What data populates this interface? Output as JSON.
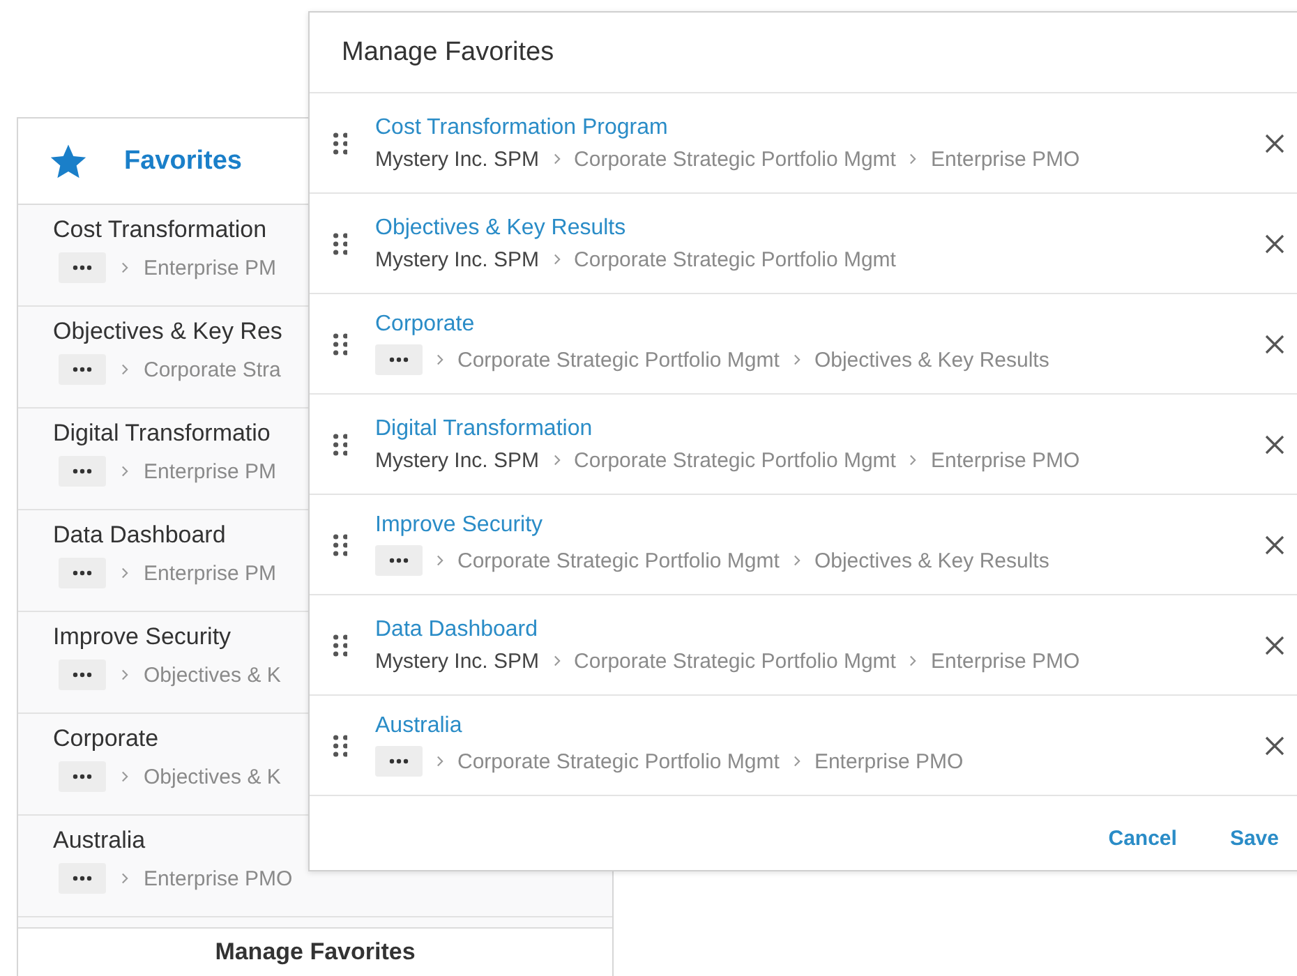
{
  "favorites_panel": {
    "title": "Favorites",
    "items": [
      {
        "title": "Cost Transformation",
        "path": [
          {
            "kind": "more"
          },
          {
            "kind": "crumb",
            "label": "Enterprise PM"
          }
        ]
      },
      {
        "title": "Objectives & Key Res",
        "path": [
          {
            "kind": "more"
          },
          {
            "kind": "crumb",
            "label": "Corporate Stra"
          }
        ]
      },
      {
        "title": "Digital Transformatio",
        "path": [
          {
            "kind": "more"
          },
          {
            "kind": "crumb",
            "label": "Enterprise PM"
          }
        ]
      },
      {
        "title": "Data Dashboard",
        "path": [
          {
            "kind": "more"
          },
          {
            "kind": "crumb",
            "label": "Enterprise PM"
          }
        ]
      },
      {
        "title": "Improve Security",
        "path": [
          {
            "kind": "more"
          },
          {
            "kind": "crumb",
            "label": "Objectives & K"
          }
        ]
      },
      {
        "title": "Corporate",
        "path": [
          {
            "kind": "more"
          },
          {
            "kind": "crumb",
            "label": "Objectives & K"
          }
        ]
      },
      {
        "title": "Australia",
        "path": [
          {
            "kind": "more"
          },
          {
            "kind": "crumb",
            "label": "Enterprise PMO"
          }
        ]
      }
    ],
    "footer_button": "Manage Favorites"
  },
  "dialog": {
    "title": "Manage Favorites",
    "items": [
      {
        "title": "Cost Transformation Program",
        "path": [
          {
            "kind": "root",
            "label": "Mystery Inc. SPM"
          },
          {
            "kind": "crumb",
            "label": "Corporate Strategic Portfolio Mgmt"
          },
          {
            "kind": "crumb",
            "label": "Enterprise PMO"
          }
        ]
      },
      {
        "title": "Objectives & Key Results",
        "path": [
          {
            "kind": "root",
            "label": "Mystery Inc. SPM"
          },
          {
            "kind": "crumb",
            "label": "Corporate Strategic Portfolio Mgmt"
          }
        ]
      },
      {
        "title": "Corporate",
        "path": [
          {
            "kind": "more"
          },
          {
            "kind": "crumb",
            "label": "Corporate Strategic Portfolio Mgmt"
          },
          {
            "kind": "crumb",
            "label": "Objectives & Key Results"
          }
        ]
      },
      {
        "title": "Digital Transformation",
        "path": [
          {
            "kind": "root",
            "label": "Mystery Inc. SPM"
          },
          {
            "kind": "crumb",
            "label": "Corporate Strategic Portfolio Mgmt"
          },
          {
            "kind": "crumb",
            "label": "Enterprise PMO"
          }
        ]
      },
      {
        "title": "Improve Security",
        "path": [
          {
            "kind": "more"
          },
          {
            "kind": "crumb",
            "label": "Corporate Strategic Portfolio Mgmt"
          },
          {
            "kind": "crumb",
            "label": "Objectives & Key Results"
          }
        ]
      },
      {
        "title": "Data Dashboard",
        "path": [
          {
            "kind": "root",
            "label": "Mystery Inc. SPM"
          },
          {
            "kind": "crumb",
            "label": "Corporate Strategic Portfolio Mgmt"
          },
          {
            "kind": "crumb",
            "label": "Enterprise PMO"
          }
        ]
      },
      {
        "title": "Australia",
        "path": [
          {
            "kind": "more"
          },
          {
            "kind": "crumb",
            "label": "Corporate Strategic Portfolio Mgmt"
          },
          {
            "kind": "crumb",
            "label": "Enterprise PMO"
          }
        ]
      }
    ],
    "buttons": [
      "Cancel",
      "Save"
    ]
  }
}
